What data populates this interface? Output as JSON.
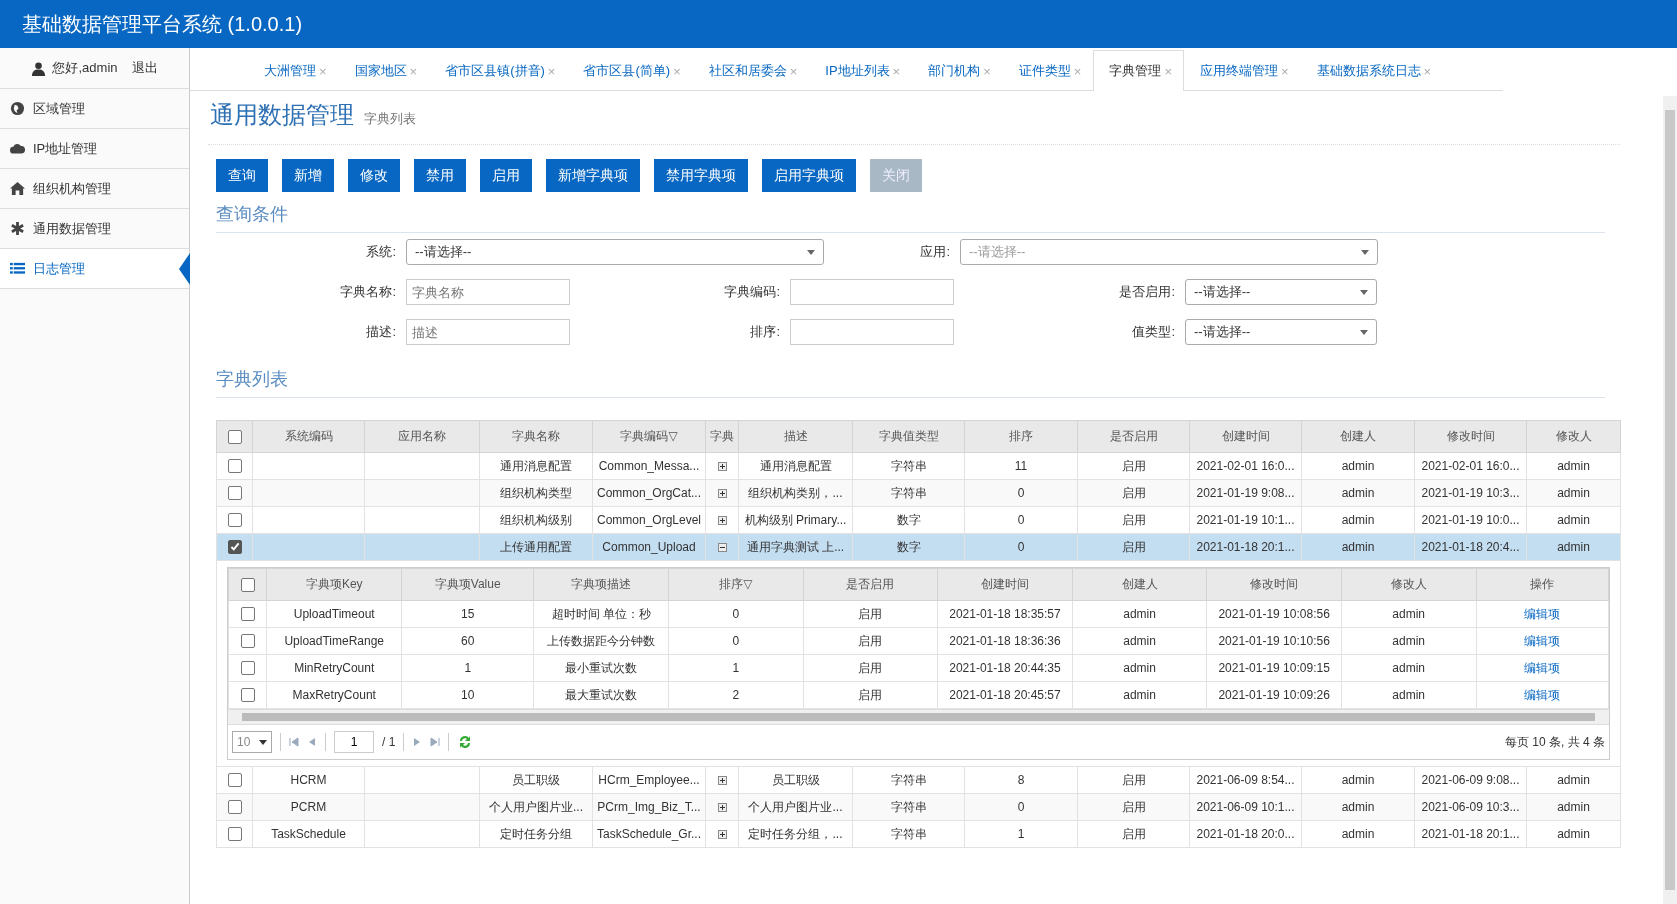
{
  "app_title": "基础数据管理平台系统 (1.0.0.1)",
  "user": {
    "greeting": "您好,admin",
    "logout": "退出"
  },
  "sidebar": {
    "items": [
      {
        "label": "区域管理",
        "selected": false
      },
      {
        "label": "IP地址管理",
        "selected": false
      },
      {
        "label": "组织机构管理",
        "selected": false
      },
      {
        "label": "通用数据管理",
        "selected": false
      },
      {
        "label": "日志管理",
        "selected": true
      }
    ]
  },
  "tabs": [
    {
      "label": "大洲管理",
      "close": "×",
      "selected": false
    },
    {
      "label": "国家地区",
      "close": "×",
      "selected": false
    },
    {
      "label": "省市区县镇(拼音)",
      "close": "×",
      "selected": false
    },
    {
      "label": "省市区县(简单)",
      "close": "×",
      "selected": false
    },
    {
      "label": "社区和居委会",
      "close": "×",
      "selected": false
    },
    {
      "label": "IP地址列表",
      "close": "×",
      "selected": false
    },
    {
      "label": "部门机构",
      "close": "×",
      "selected": false
    },
    {
      "label": "证件类型",
      "close": "×",
      "selected": false
    },
    {
      "label": "字典管理",
      "close": "×",
      "selected": true
    },
    {
      "label": "应用终端管理",
      "close": "×",
      "selected": false
    },
    {
      "label": "基础数据系统日志",
      "close": "×",
      "selected": false
    }
  ],
  "page": {
    "title": "通用数据管理",
    "subtitle": "字典列表"
  },
  "toolbar": [
    {
      "label": "查询",
      "disabled": false
    },
    {
      "label": "新增",
      "disabled": false
    },
    {
      "label": "修改",
      "disabled": false
    },
    {
      "label": "禁用",
      "disabled": false
    },
    {
      "label": "启用",
      "disabled": false
    },
    {
      "label": "新增字典项",
      "disabled": false
    },
    {
      "label": "禁用字典项",
      "disabled": false
    },
    {
      "label": "启用字典项",
      "disabled": false
    },
    {
      "label": "关闭",
      "disabled": true
    }
  ],
  "query": {
    "title": "查询条件",
    "rows": [
      [
        {
          "label": "系统:",
          "kind": "select",
          "value": "--请选择--"
        },
        {
          "label": "应用:",
          "kind": "select",
          "placeholder": "--请选择--"
        }
      ],
      [
        {
          "label": "字典名称:",
          "kind": "input",
          "placeholder": "字典名称"
        },
        {
          "label": "字典编码:",
          "kind": "input"
        },
        {
          "label": "是否启用:",
          "kind": "select",
          "value": "--请选择--"
        }
      ],
      [
        {
          "label": "描述:",
          "kind": "input",
          "placeholder": "描述"
        },
        {
          "label": "排序:",
          "kind": "input"
        },
        {
          "label": "值类型:",
          "kind": "select",
          "value": "--请选择--"
        }
      ]
    ]
  },
  "list": {
    "title": "字典列表",
    "all_checked": false,
    "columns": [
      "系统编码",
      "应用名称",
      "字典名称",
      "字典编码▽",
      "字典",
      "描述",
      "字典值类型",
      "排序",
      "是否启用",
      "创建时间",
      "创建人",
      "修改时间",
      "修改人"
    ],
    "rows": [
      {
        "checked": false,
        "selected": false,
        "expanded": false,
        "cells": [
          "",
          "",
          "通用消息配置",
          "Common_Messa...",
          "",
          "通用消息配置",
          "字符串",
          "11",
          "启用",
          "2021-02-01 16:0...",
          "admin",
          "2021-02-01 16:0...",
          "admin"
        ]
      },
      {
        "checked": false,
        "selected": false,
        "expanded": false,
        "cells": [
          "",
          "",
          "组织机构类型",
          "Common_OrgCat...",
          "",
          "组织机构类别，...",
          "字符串",
          "0",
          "启用",
          "2021-01-19 9:08...",
          "admin",
          "2021-01-19 10:3...",
          "admin"
        ]
      },
      {
        "checked": false,
        "selected": false,
        "expanded": false,
        "cells": [
          "",
          "",
          "组织机构级别",
          "Common_OrgLevel",
          "",
          "机构级别 Primary...",
          "数字",
          "0",
          "启用",
          "2021-01-19 10:1...",
          "admin",
          "2021-01-19 10:0...",
          "admin"
        ]
      },
      {
        "checked": true,
        "selected": true,
        "expanded": true,
        "cells": [
          "",
          "",
          "上传通用配置",
          "Common_Upload",
          "",
          "通用字典测试 上...",
          "数字",
          "0",
          "启用",
          "2021-01-18 20:1...",
          "admin",
          "2021-01-18 20:4...",
          "admin"
        ],
        "detail": {
          "all_checked": false,
          "columns": [
            "字典项Key",
            "字典项Value",
            "字典项描述",
            "排序▽",
            "是否启用",
            "创建时间",
            "创建人",
            "修改时间",
            "修改人",
            "操作"
          ],
          "rows": [
            {
              "checked": false,
              "cells": [
                "UploadTimeout",
                "15",
                "超时时间 单位：秒",
                "0",
                "启用",
                "2021-01-18 18:35:57",
                "admin",
                "2021-01-19 10:08:56",
                "admin"
              ],
              "action": "编辑项"
            },
            {
              "checked": false,
              "cells": [
                "UploadTimeRange",
                "60",
                "上传数据距今分钟数",
                "0",
                "启用",
                "2021-01-18 18:36:36",
                "admin",
                "2021-01-19 10:10:56",
                "admin"
              ],
              "action": "编辑项"
            },
            {
              "checked": false,
              "cells": [
                "MinRetryCount",
                "1",
                "最小重试次数",
                "1",
                "启用",
                "2021-01-18 20:44:35",
                "admin",
                "2021-01-19 10:09:15",
                "admin"
              ],
              "action": "编辑项"
            },
            {
              "checked": false,
              "cells": [
                "MaxRetryCount",
                "10",
                "最大重试次数",
                "2",
                "启用",
                "2021-01-18 20:45:57",
                "admin",
                "2021-01-19 10:09:26",
                "admin"
              ],
              "action": "编辑项"
            }
          ],
          "pager": {
            "page_size": "10",
            "page": "1",
            "total_pages": "/ 1",
            "summary": "每页 10 条, 共 4 条"
          }
        }
      },
      {
        "checked": false,
        "selected": false,
        "expanded": false,
        "cells": [
          "HCRM",
          "",
          "员工职级",
          "HCrm_Employee...",
          "",
          "员工职级",
          "字符串",
          "8",
          "启用",
          "2021-06-09 8:54...",
          "admin",
          "2021-06-09 9:08...",
          "admin"
        ]
      },
      {
        "checked": false,
        "selected": false,
        "expanded": false,
        "cells": [
          "PCRM",
          "",
          "个人用户图片业...",
          "PCrm_Img_Biz_T...",
          "",
          "个人用户图片业...",
          "字符串",
          "0",
          "启用",
          "2021-06-09 10:1...",
          "admin",
          "2021-06-09 10:3...",
          "admin"
        ]
      },
      {
        "checked": false,
        "selected": false,
        "expanded": false,
        "cells": [
          "TaskSchedule",
          "",
          "定时任务分组",
          "TaskSchedule_Gr...",
          "",
          "定时任务分组，...",
          "字符串",
          "1",
          "启用",
          "2021-01-18 20:0...",
          "admin",
          "2021-01-18 20:1...",
          "admin"
        ]
      }
    ]
  }
}
